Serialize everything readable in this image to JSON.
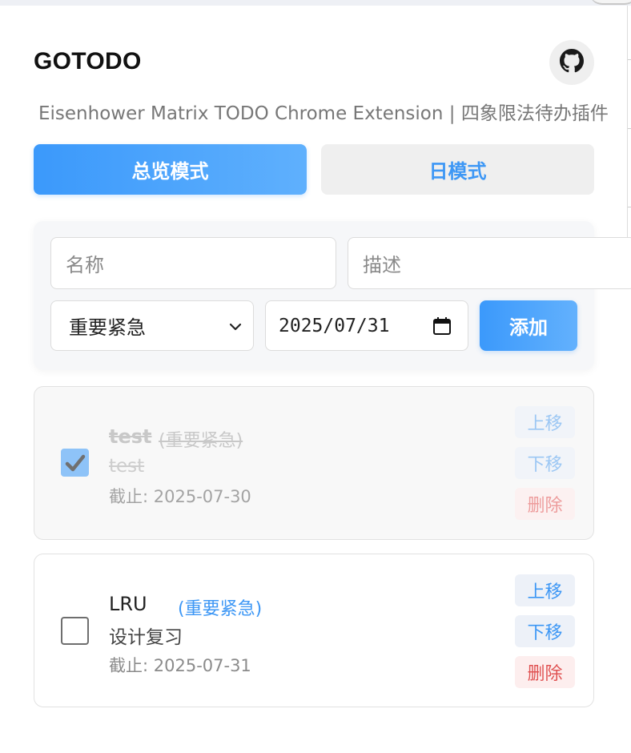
{
  "app": {
    "title": "GOTODO",
    "subtitle": "Eisenhower Matrix TODO Chrome Extension | 四象限法待办插件",
    "github_icon": "github-icon"
  },
  "modes": {
    "overview_label": "总览模式",
    "day_label": "日模式",
    "active": "overview"
  },
  "form": {
    "name_placeholder": "名称",
    "desc_placeholder": "描述",
    "quadrant_selected": "重要紧急",
    "date_value": "2025/07/31",
    "add_label": "添加"
  },
  "tasks": [
    {
      "name": "test",
      "quadrant": "(重要紧急)",
      "description": "test",
      "due": "截止: 2025-07-30",
      "completed": true,
      "up_label": "上移",
      "down_label": "下移",
      "delete_label": "删除"
    },
    {
      "name": "LRU",
      "quadrant": "(重要紧急)",
      "description": "设计复习",
      "due": "截止: 2025-07-31",
      "completed": false,
      "up_label": "上移",
      "down_label": "下移",
      "delete_label": "删除"
    }
  ],
  "colors": {
    "accent": "#3d97f5",
    "delete": "#e05252"
  }
}
